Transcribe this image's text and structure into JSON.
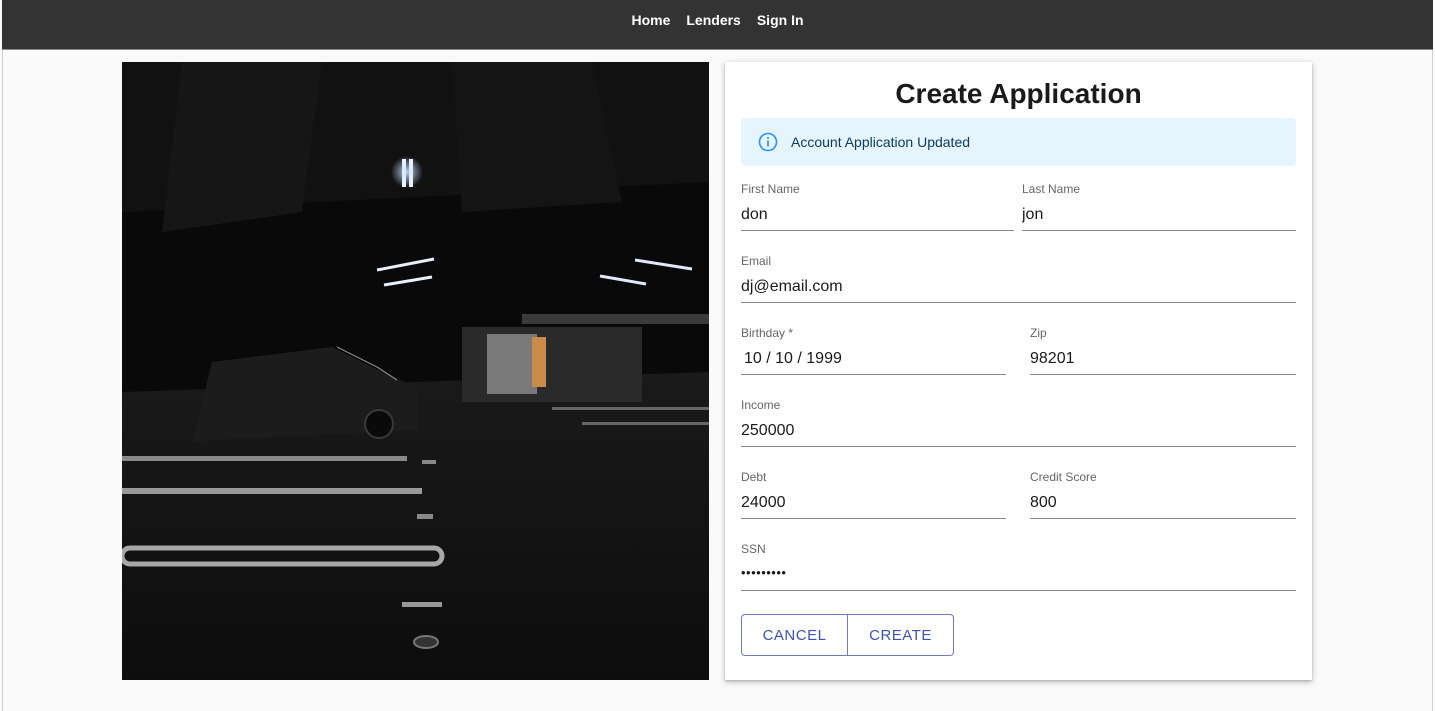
{
  "nav": {
    "links": [
      "Home",
      "Lenders",
      "Sign In"
    ]
  },
  "form": {
    "title": "Create Application",
    "alert": {
      "icon": "info-icon",
      "message": "Account Application Updated"
    },
    "fields": {
      "first_name": {
        "label": "First Name",
        "value": "don"
      },
      "last_name": {
        "label": "Last Name",
        "value": "jon"
      },
      "email": {
        "label": "Email",
        "value": "dj@email.com"
      },
      "birthday": {
        "label": "Birthday *",
        "value": "10 / 10 / 1999"
      },
      "zip": {
        "label": "Zip",
        "value": "98201"
      },
      "income": {
        "label": "Income",
        "value": "250000"
      },
      "debt": {
        "label": "Debt",
        "value": "24000"
      },
      "credit_score": {
        "label": "Credit Score",
        "value": "800"
      },
      "ssn": {
        "label": "SSN",
        "value": "•••••••••"
      }
    },
    "buttons": {
      "cancel": "CANCEL",
      "create": "CREATE"
    }
  },
  "colors": {
    "navbar": "#333333",
    "accent": "#3f51b5",
    "alert_bg": "#e5f4fd",
    "alert_icon": "#2196f3"
  }
}
